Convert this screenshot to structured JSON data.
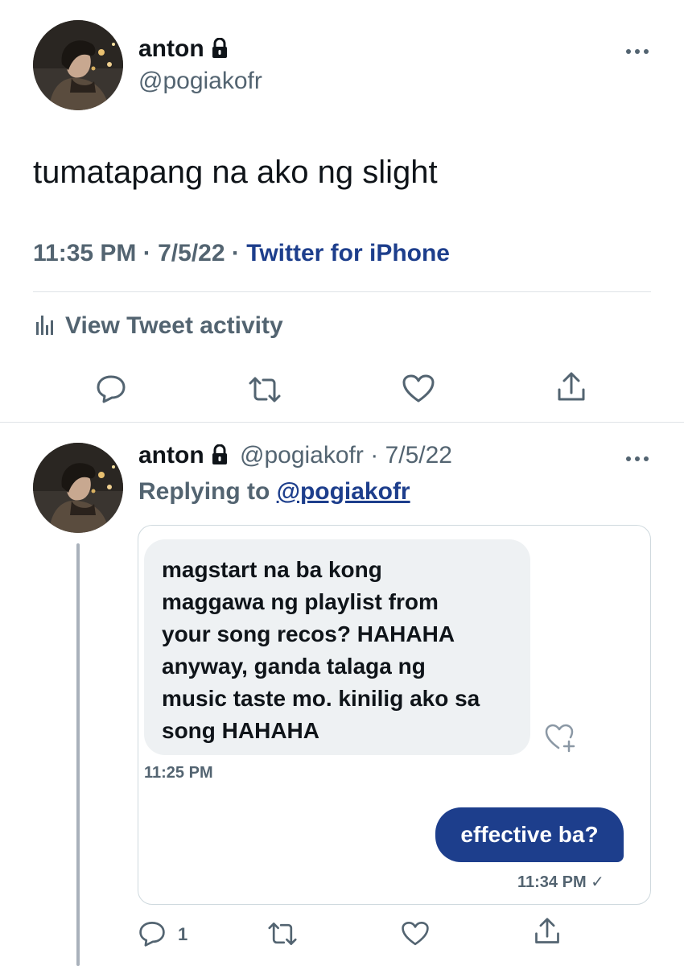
{
  "main_tweet": {
    "name": "anton",
    "handle": "@pogiakofr",
    "text": "tumatapang na ako ng slight",
    "time": "11:35 PM",
    "date": "7/5/22",
    "sep": "·",
    "source": "Twitter for iPhone",
    "activity_label": "View Tweet activity"
  },
  "reply_tweet": {
    "name": "anton",
    "handle": "@pogiakofr",
    "sep": "·",
    "date": "7/5/22",
    "replying_prefix": "Replying to",
    "replying_to": "@pogiakofr",
    "reply_count": "1",
    "dm": {
      "incoming_lines": [
        "magstart na ba kong",
        "maggawa ng playlist from",
        "your song recos? HAHAHA",
        "anyway, ganda talaga ng",
        "music taste mo. kinilig ako sa",
        "song HAHAHA"
      ],
      "incoming_time": "11:25 PM",
      "outgoing_text": "effective ba?",
      "outgoing_time": "11:34 PM",
      "outgoing_status": "✓"
    }
  },
  "colors": {
    "link_blue": "#1d3e8c",
    "secondary_text": "#536471",
    "divider": "#dfe3e7",
    "bubble_in": "#eef1f3"
  },
  "icons": [
    "lock-icon",
    "more-icon",
    "analytics-icon",
    "reply-icon",
    "retweet-icon",
    "like-icon",
    "share-icon",
    "heart-plus-icon"
  ]
}
